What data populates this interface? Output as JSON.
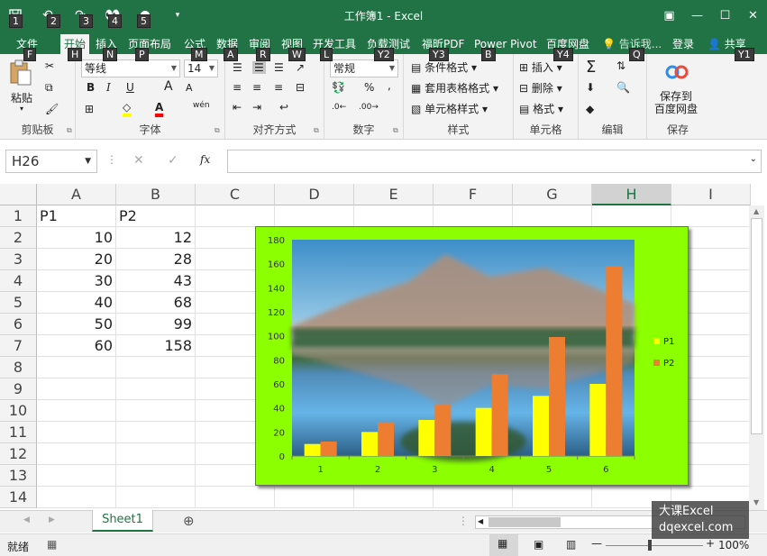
{
  "window": {
    "title": "工作簿1 - Excel",
    "qat_keytips": [
      "1",
      "2",
      "3",
      "4",
      "5"
    ]
  },
  "tabs": [
    {
      "label": "文件",
      "keytip": "F"
    },
    {
      "label": "开始",
      "keytip": "H",
      "active": true
    },
    {
      "label": "插入",
      "keytip": "N"
    },
    {
      "label": "页面布局",
      "keytip": "P"
    },
    {
      "label": "公式",
      "keytip": "M"
    },
    {
      "label": "数据",
      "keytip": "A"
    },
    {
      "label": "审阅",
      "keytip": "R"
    },
    {
      "label": "视图",
      "keytip": "W"
    },
    {
      "label": "开发工具",
      "keytip": "L"
    },
    {
      "label": "负载测试",
      "keytip": "Y2"
    },
    {
      "label": "福昕PDF",
      "keytip": "Y3"
    },
    {
      "label": "Power Pivot",
      "keytip": "B"
    },
    {
      "label": "百度网盘",
      "keytip": "Y4"
    }
  ],
  "tell_me": {
    "text": "告诉我...",
    "keytip": "Q"
  },
  "signin": "登录",
  "share": {
    "label": "共享",
    "keytip": "Y1"
  },
  "ribbon": {
    "clipboard": {
      "label": "剪贴板",
      "paste": "粘贴"
    },
    "font": {
      "label": "字体",
      "name": "等线",
      "size": "14",
      "bold": "B",
      "italic": "I",
      "underline": "U",
      "grow": "A",
      "shrink": "A",
      "phonetic": "wén"
    },
    "alignment": {
      "label": "对齐方式"
    },
    "number": {
      "label": "数字",
      "format": "常规",
      "percent": "%",
      "comma": ","
    },
    "styles": {
      "label": "样式",
      "conditional": "条件格式",
      "table": "套用表格格式",
      "cell": "单元格样式"
    },
    "cells": {
      "label": "单元格",
      "insert": "插入",
      "delete": "删除",
      "format": "格式"
    },
    "editing": {
      "label": "编辑"
    },
    "save": {
      "label": "保存",
      "button": "保存到\n百度网盘"
    }
  },
  "formula_bar": {
    "name_box": "H26",
    "fx": "fx",
    "value": ""
  },
  "sheet": {
    "columns": [
      "A",
      "B",
      "C",
      "D",
      "E",
      "F",
      "G",
      "H",
      "I"
    ],
    "selected_column": "H",
    "rows": [
      "1",
      "2",
      "3",
      "4",
      "5",
      "6",
      "7",
      "8",
      "9",
      "10",
      "11",
      "12",
      "13",
      "14"
    ],
    "cells": {
      "A1": "P1",
      "B1": "P2",
      "A2": "10",
      "B2": "12",
      "A3": "20",
      "B3": "28",
      "A4": "30",
      "B4": "43",
      "A5": "40",
      "B5": "68",
      "A6": "50",
      "B6": "99",
      "A7": "60",
      "B7": "158"
    }
  },
  "chart_data": {
    "type": "bar",
    "categories": [
      "1",
      "2",
      "3",
      "4",
      "5",
      "6"
    ],
    "series": [
      {
        "name": "P1",
        "values": [
          10,
          20,
          30,
          40,
          50,
          60
        ],
        "color": "#ffff00"
      },
      {
        "name": "P2",
        "values": [
          12,
          28,
          43,
          68,
          99,
          158
        ],
        "color": "#ed7d31"
      }
    ],
    "ylim": [
      0,
      180
    ],
    "yticks": [
      0,
      20,
      40,
      60,
      80,
      100,
      120,
      140,
      160,
      180
    ],
    "legend": "right",
    "grid": false,
    "background": "#8cff00",
    "plot_background": "photo: mountain lake landscape"
  },
  "sheet_tabs": {
    "active": "Sheet1"
  },
  "status": {
    "ready": "就绪",
    "zoom": "100%"
  },
  "watermark": {
    "line1": "大课Excel",
    "line2": "dqexcel.com"
  }
}
